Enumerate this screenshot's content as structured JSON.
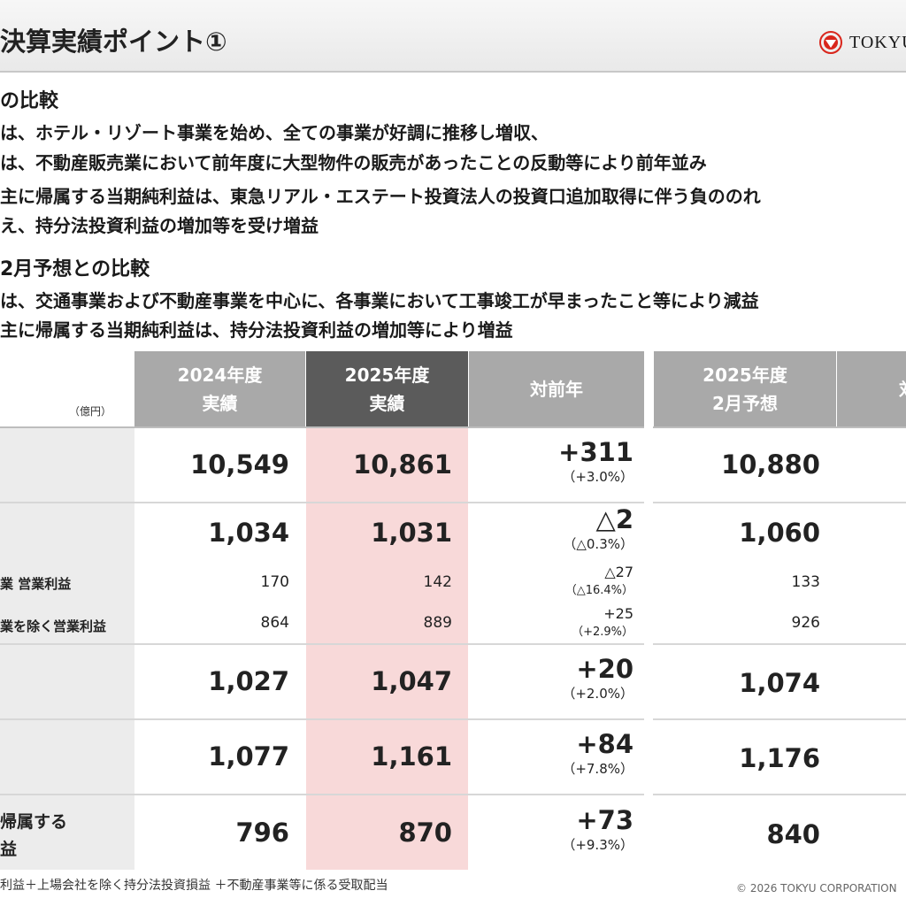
{
  "header": {
    "title": "決算実績ポイント①",
    "logo_text": "TOKYU"
  },
  "comparison_prior": {
    "heading": "の比較",
    "lines": [
      "は、ホテル・リゾート事業を始め、全ての事業が好調に推移し増収、",
      "は、不動産販売業において前年度に大型物件の販売があったことの反動等により前年並み",
      "主に帰属する当期純利益は、東急リアル・エステート投資法人の投資口追加取得に伴う負ののれ",
      "え、持分法投資利益の増加等を受け増益"
    ]
  },
  "comparison_forecast": {
    "heading": "2月予想との比較",
    "lines": [
      "は、交通事業および不動産事業を中心に、各事業において工事竣工が早まったこと等により減益",
      "主に帰属する当期純利益は、持分法投資利益の増加等により増益"
    ]
  },
  "table": {
    "unit": "（億円）",
    "headers": {
      "fy2024": [
        "2024年度",
        "実績"
      ],
      "fy2025": [
        "2025年度",
        "実績"
      ],
      "yoy": "対前年",
      "forecast": [
        "2025年度",
        "2月予想"
      ],
      "vs_forecast": "対"
    },
    "rows": [
      {
        "label": "",
        "fy2024": "10,549",
        "fy2025": "10,861",
        "yoy": "+311",
        "yoy_pct": "（+3.0%）",
        "forecast": "10,880"
      },
      {
        "label": "",
        "fy2024": "1,034",
        "fy2025": "1,031",
        "yoy": "△2",
        "yoy_pct": "（△0.3%）",
        "forecast": "1,060"
      },
      {
        "label": "業 営業利益",
        "fy2024": "170",
        "fy2025": "142",
        "yoy": "△27",
        "yoy_pct": "（△16.4%）",
        "forecast": "133"
      },
      {
        "label": "業を除く営業利益",
        "fy2024": "864",
        "fy2025": "889",
        "yoy": "+25",
        "yoy_pct": "（+2.9%）",
        "forecast": "926"
      },
      {
        "label": "",
        "fy2024": "1,027",
        "fy2025": "1,047",
        "yoy": "+20",
        "yoy_pct": "（+2.0%）",
        "forecast": "1,074"
      },
      {
        "label": "",
        "fy2024": "1,077",
        "fy2025": "1,161",
        "yoy": "+84",
        "yoy_pct": "（+7.8%）",
        "forecast": "1,176"
      },
      {
        "label": "帰属する",
        "label2": "益",
        "fy2024": "796",
        "fy2025": "870",
        "yoy": "+73",
        "yoy_pct": "（+9.3%）",
        "forecast": "840"
      }
    ]
  },
  "footer": {
    "note": "利益＋上場会社を除く持分法投資損益 ＋不動産事業等に係る受取配当",
    "copyright": "© 2026 TOKYU CORPORATION"
  },
  "colors": {
    "header_gray": "#a9a9a9",
    "header_dark": "#5b5b5b",
    "highlight_pink": "#f8d9d9",
    "logo_red": "#d9261c"
  },
  "icons": {
    "logo": "tokyu-logo-icon"
  }
}
